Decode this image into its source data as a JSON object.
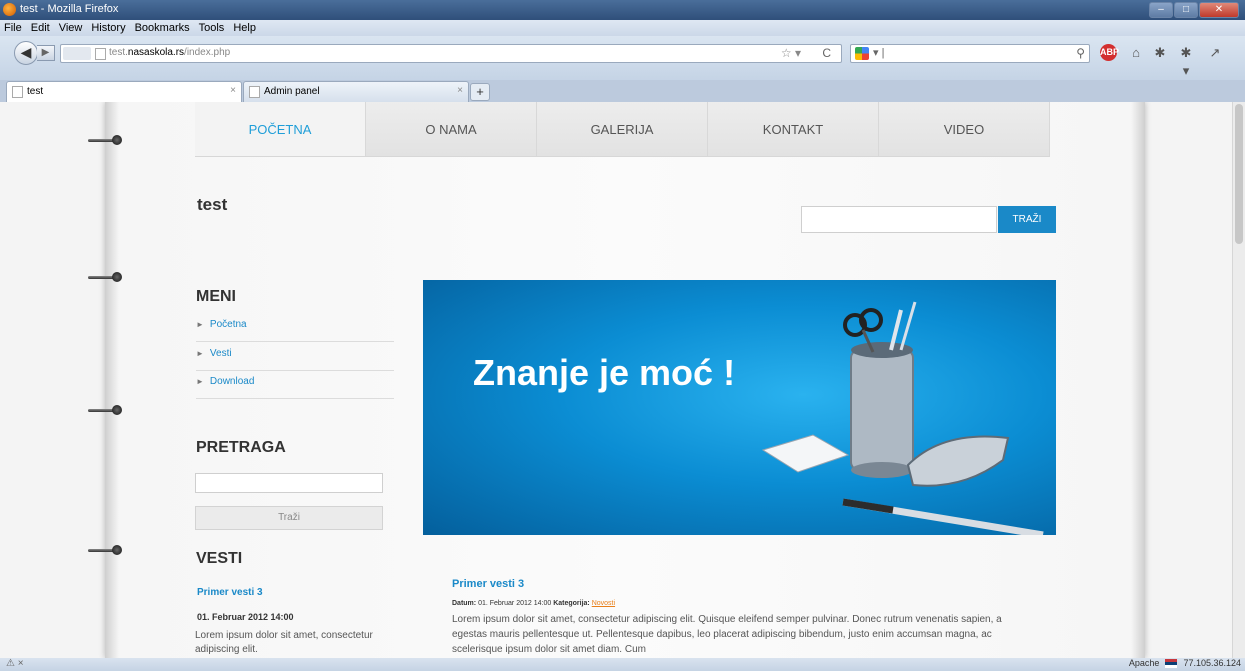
{
  "window": {
    "title": "test - Mozilla Firefox",
    "controls": {
      "minimize": "–",
      "maximize": "□",
      "close": "✕"
    }
  },
  "menubar": [
    "File",
    "Edit",
    "View",
    "History",
    "Bookmarks",
    "Tools",
    "Help"
  ],
  "navbar": {
    "back_glyph": "◀",
    "forward_glyph": "▶",
    "url_prefix": "test.",
    "url_domain": "nasaskola.rs",
    "url_path": "/index.php",
    "star_glyph": "☆ ▾",
    "reload_glyph": "C",
    "search_value": "",
    "search_caret": "▾ |",
    "search_go": "⚲",
    "icons": {
      "abp": "ABP",
      "home": "⌂",
      "tools": "✱",
      "tools2": "✱ ▾",
      "tools3": "↗"
    }
  },
  "tabs": [
    {
      "label": "test",
      "close": "×"
    },
    {
      "label": "Admin panel",
      "close": "×"
    }
  ],
  "newtab": "+",
  "site": {
    "nav": [
      "POČETNA",
      "O NAMA",
      "GALERIJA",
      "KONTAKT",
      "VIDEO"
    ],
    "title": "test",
    "search_button": "TRAŽI",
    "sidebar": {
      "menu_heading": "MENI",
      "menu_items": [
        "Početna",
        "Vesti",
        "Download"
      ],
      "search_heading": "PRETRAGA",
      "search_button": "Traži",
      "news_heading": "VESTI",
      "news_title": "Primer vesti 3",
      "news_date": "01. Februar 2012 14:00",
      "news_text": "Lorem ipsum dolor sit amet, consectetur adipiscing elit."
    },
    "banner_text": "Znanje je moć !",
    "article": {
      "title": "Primer vesti 3",
      "date_label": "Datum:",
      "date": "01. Februar 2012 14:00",
      "category_label": "Kategorija:",
      "category": "Novosti",
      "body": "Lorem ipsum dolor sit amet, consectetur adipiscing elit. Quisque eleifend semper pulvinar. Donec rutrum venenatis sapien, a egestas mauris pellentesque ut. Pellentesque dapibus, leo placerat adipiscing bibendum, justo enim accumsan magna, ac scelerisque ipsum dolor sit amet diam. Cum"
    }
  },
  "statusbar": {
    "left": "⚠ ×",
    "apache": "Apache",
    "ip": "77.105.36.124"
  },
  "colors": {
    "accent": "#1a89c8",
    "active_nav": "#1f9ed8",
    "category_link": "#e87f1a"
  }
}
